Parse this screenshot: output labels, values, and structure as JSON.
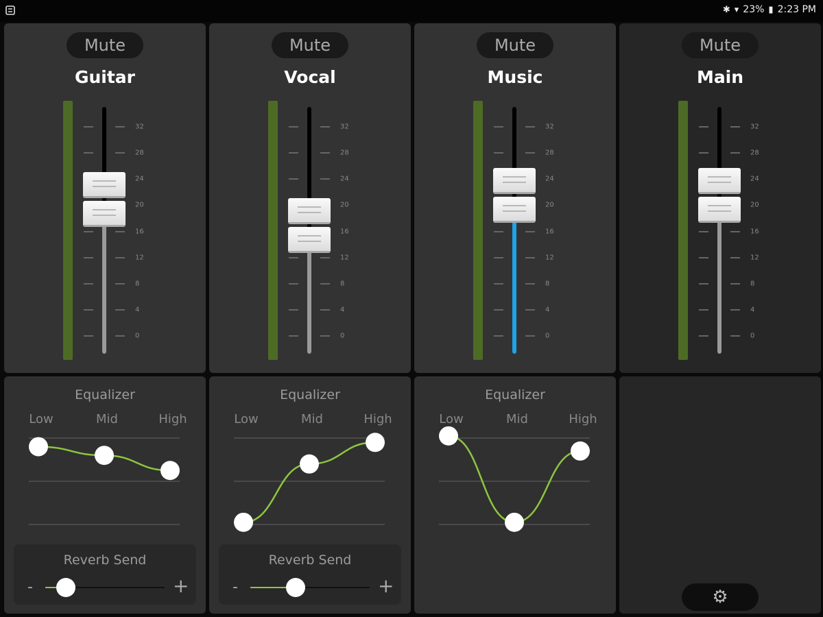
{
  "status_bar": {
    "battery": "23%",
    "time": "2:23 PM",
    "icons": [
      "app-icon",
      "bluetooth-icon",
      "wifi-icon",
      "battery-icon"
    ]
  },
  "scale_labels": [
    "32",
    "28",
    "24",
    "20",
    "16",
    "12",
    "8",
    "4",
    "0"
  ],
  "mute_label": "Mute",
  "channels": [
    {
      "name": "Guitar",
      "level": 20.6,
      "meter": "green"
    },
    {
      "name": "Vocal",
      "level": 16.6,
      "meter": "green"
    },
    {
      "name": "Music",
      "level": 21.2,
      "meter": "green",
      "fill_color": "#1ea3e8"
    },
    {
      "name": "Main",
      "level": 21.2,
      "meter": "green"
    }
  ],
  "equalizer": {
    "title": "Equalizer",
    "bands": [
      "Low",
      "Mid",
      "High"
    ],
    "curves": [
      {
        "channel": "Guitar",
        "low": 0.8,
        "mid": 0.6,
        "high": 0.25
      },
      {
        "channel": "Vocal",
        "low": -0.95,
        "mid": 0.4,
        "high": 0.9
      },
      {
        "channel": "Music",
        "low": 1.05,
        "mid": -0.95,
        "high": 0.7
      }
    ]
  },
  "reverb": {
    "title": "Reverb Send",
    "minus": "-",
    "plus": "+",
    "sends": [
      {
        "channel": "Guitar",
        "value": 0.17
      },
      {
        "channel": "Vocal",
        "value": 0.38
      }
    ]
  },
  "settings_icon": "gear-icon",
  "colors": {
    "eq_curve": "#8dc63f",
    "meter": "#4e6b26",
    "music_fader": "#1ea3e8"
  }
}
